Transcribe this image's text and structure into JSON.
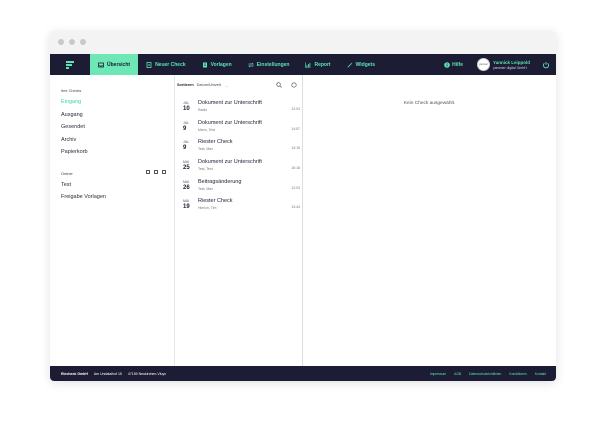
{
  "window": {
    "dots": 3
  },
  "nav": {
    "items": [
      {
        "label": "Übersicht",
        "icon": "inbox-icon",
        "active": true
      },
      {
        "label": "Neuer Check",
        "icon": "document-plus-icon"
      },
      {
        "label": "Vorlagen",
        "icon": "template-icon"
      },
      {
        "label": "Einstellungen",
        "icon": "settings-arrows-icon"
      },
      {
        "label": "Report",
        "icon": "bar-chart-icon"
      },
      {
        "label": "Widgets",
        "icon": "widget-wand-icon"
      }
    ],
    "help": "Hilfe",
    "user_name": "Yannick Leippold",
    "user_company": "yammer digital GmbH",
    "avatar_text": "yammer"
  },
  "sidebar": {
    "section_checks": "Ihre Checks",
    "items": [
      "Eingang",
      "Ausgang",
      "Gesendet",
      "Archiv",
      "Papierkorb"
    ],
    "section_folders": "Ordner",
    "folders": [
      "Test",
      "Freigabe Vorlagen"
    ]
  },
  "list": {
    "sort_label": "Sortieren",
    "sort_value": "Datum/Uhrzeit",
    "rows": [
      {
        "month": "JUL",
        "day": "10",
        "title": "Dokument zur Unterschrift",
        "sub": "Radio",
        "time": "12:03"
      },
      {
        "month": "JUL",
        "day": "9",
        "title": "Dokument zur Unterschrift",
        "sub": "Mann, Test",
        "time": "14:57"
      },
      {
        "month": "JUL",
        "day": "9",
        "title": "Riester Check",
        "sub": "Test, Max",
        "time": "14:15"
      },
      {
        "month": "MAI",
        "day": "25",
        "title": "Dokument zur Unterschrift",
        "sub": "Test, Test",
        "time": "16:18"
      },
      {
        "month": "MAI",
        "day": "26",
        "title": "Beitragsänderung",
        "sub": "Test, Max",
        "time": "12:03"
      },
      {
        "month": "MAI",
        "day": "19",
        "title": "Riester Check",
        "sub": "Hinrich, Tim",
        "time": "13:44"
      }
    ]
  },
  "detail": {
    "empty_text": "Kein Check ausgewählt."
  },
  "footer": {
    "company": "Riecheck GmbH",
    "street": "Am Undatalhof 15",
    "city": "47159 Neukirchen-Vluyn",
    "links": [
      "Impressum",
      "AGB",
      "Datenschutzrichtlinien",
      "Konditionen",
      "Kontakt"
    ]
  },
  "colors": {
    "nav_bg": "#1d1c35",
    "accent": "#59e6b3",
    "active_tab": "#6ee7b7"
  }
}
